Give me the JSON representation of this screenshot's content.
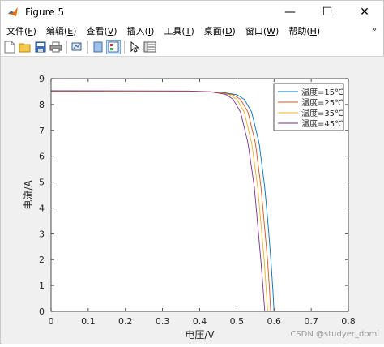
{
  "window": {
    "title": "Figure 5",
    "minimize_glyph": "—",
    "maximize_glyph": "☐",
    "close_glyph": "✕"
  },
  "menu": [
    {
      "label": "文件(F)",
      "text": "文件(",
      "key": "F",
      "end": ")"
    },
    {
      "label": "编辑(E)",
      "text": "编辑(",
      "key": "E",
      "end": ")"
    },
    {
      "label": "查看(V)",
      "text": "查看(",
      "key": "V",
      "end": ")"
    },
    {
      "label": "插入(I)",
      "text": "插入(",
      "key": "I",
      "end": ")"
    },
    {
      "label": "工具(T)",
      "text": "工具(",
      "key": "T",
      "end": ")"
    },
    {
      "label": "桌面(D)",
      "text": "桌面(",
      "key": "D",
      "end": ")"
    },
    {
      "label": "窗口(W)",
      "text": "窗口(",
      "key": "W",
      "end": ")"
    },
    {
      "label": "帮助(H)",
      "text": "帮助(",
      "key": "H",
      "end": ")"
    }
  ],
  "menu_expand_glyph": "»",
  "toolbar": {
    "icons": [
      "new-figure-icon",
      "open-file-icon",
      "save-icon",
      "print-icon",
      "link-plot-icon",
      "hide-plot-tools-icon",
      "show-plot-tools-icon",
      "edit-plot-arrow-icon",
      "property-inspector-icon"
    ]
  },
  "watermark": "CSDN @studyer_domi",
  "chart_data": {
    "type": "line",
    "title": "",
    "xlabel": "电压/V",
    "ylabel": "电流/A",
    "xlim": [
      0,
      0.8
    ],
    "ylim": [
      0,
      9
    ],
    "xticks": [
      "0",
      "0.1",
      "0.2",
      "0.3",
      "0.4",
      "0.5",
      "0.6",
      "0.7",
      "0.8"
    ],
    "yticks": [
      "0",
      "1",
      "2",
      "3",
      "4",
      "5",
      "6",
      "7",
      "8",
      "9"
    ],
    "grid": false,
    "legend_position": "top-right",
    "series": [
      {
        "name": "温度=15℃",
        "color": "#0072bd",
        "isc": 8.5,
        "voc": 0.6,
        "points": [
          [
            0,
            8.5
          ],
          [
            0.4,
            8.49
          ],
          [
            0.46,
            8.47
          ],
          [
            0.5,
            8.38
          ],
          [
            0.52,
            8.2
          ],
          [
            0.54,
            7.7
          ],
          [
            0.56,
            6.5
          ],
          [
            0.575,
            4.8
          ],
          [
            0.585,
            3.2
          ],
          [
            0.592,
            1.9
          ],
          [
            0.597,
            0.8
          ],
          [
            0.6,
            0
          ],
          [
            0.8,
            0
          ]
        ]
      },
      {
        "name": "温度=25℃",
        "color": "#d95319",
        "isc": 8.51,
        "voc": 0.591,
        "points": [
          [
            0,
            8.51
          ],
          [
            0.39,
            8.5
          ],
          [
            0.45,
            8.47
          ],
          [
            0.49,
            8.38
          ],
          [
            0.51,
            8.2
          ],
          [
            0.53,
            7.7
          ],
          [
            0.55,
            6.5
          ],
          [
            0.565,
            4.8
          ],
          [
            0.575,
            3.2
          ],
          [
            0.583,
            1.9
          ],
          [
            0.588,
            0.8
          ],
          [
            0.591,
            0
          ],
          [
            0.8,
            0
          ]
        ]
      },
      {
        "name": "温度=35℃",
        "color": "#edb120",
        "isc": 8.52,
        "voc": 0.583,
        "points": [
          [
            0,
            8.52
          ],
          [
            0.38,
            8.51
          ],
          [
            0.44,
            8.48
          ],
          [
            0.48,
            8.38
          ],
          [
            0.5,
            8.2
          ],
          [
            0.52,
            7.7
          ],
          [
            0.54,
            6.5
          ],
          [
            0.556,
            4.8
          ],
          [
            0.566,
            3.2
          ],
          [
            0.574,
            1.9
          ],
          [
            0.579,
            0.8
          ],
          [
            0.583,
            0
          ],
          [
            0.8,
            0
          ]
        ]
      },
      {
        "name": "温度=45℃",
        "color": "#7e2f8e",
        "isc": 8.53,
        "voc": 0.575,
        "points": [
          [
            0,
            8.53
          ],
          [
            0.37,
            8.52
          ],
          [
            0.43,
            8.49
          ],
          [
            0.47,
            8.39
          ],
          [
            0.49,
            8.2
          ],
          [
            0.51,
            7.7
          ],
          [
            0.53,
            6.5
          ],
          [
            0.547,
            4.8
          ],
          [
            0.557,
            3.2
          ],
          [
            0.565,
            1.9
          ],
          [
            0.571,
            0.8
          ],
          [
            0.575,
            0
          ],
          [
            0.8,
            0
          ]
        ]
      }
    ]
  }
}
